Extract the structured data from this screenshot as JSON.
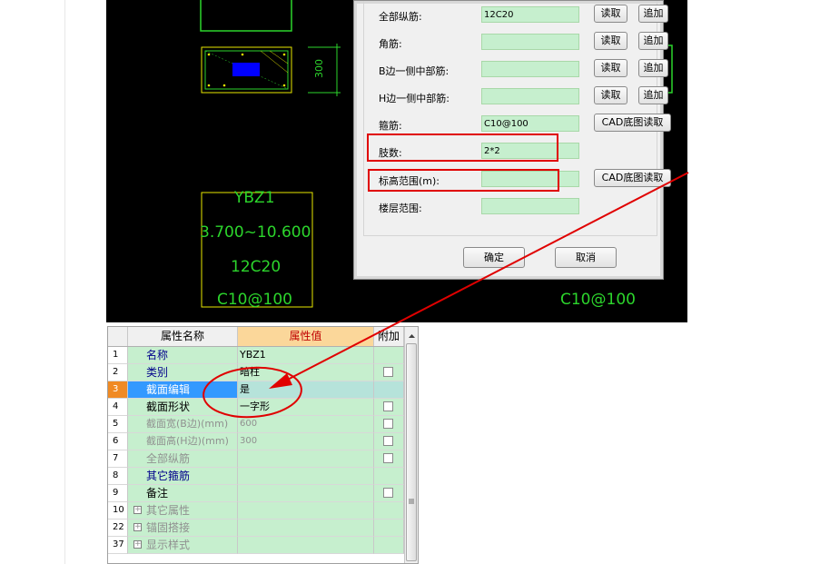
{
  "cad": {
    "dim_label": "300",
    "column_name": "YBZ1",
    "elevation": "3.700~10.600",
    "rebar": "12C20",
    "stirrup": "C10@100",
    "stirrup_right": "C10@100"
  },
  "dialog": {
    "fields": [
      {
        "label": "全部纵筋:",
        "value": "12C20",
        "read": "读取",
        "add": "追加"
      },
      {
        "label": "角筋:",
        "value": "",
        "read": "读取",
        "add": "追加"
      },
      {
        "label": "B边一侧中部筋:",
        "value": "",
        "read": "读取",
        "add": "追加"
      },
      {
        "label": "H边一侧中部筋:",
        "value": "",
        "read": "读取",
        "add": "追加"
      },
      {
        "label": "箍筋:",
        "value": "C10@100",
        "cad_read": "CAD底图读取"
      },
      {
        "label": "肢数:",
        "value": "2*2"
      },
      {
        "label": "标高范围(m):",
        "value": "",
        "cad_read": "CAD底图读取"
      },
      {
        "label": "楼层范围:",
        "value": ""
      }
    ],
    "ok": "确定",
    "cancel": "取消"
  },
  "grid": {
    "headers": {
      "num": "",
      "name": "属性名称",
      "value": "属性值",
      "add": "附加"
    },
    "rows": [
      {
        "num": "1",
        "name": "名称",
        "value": "YBZ1"
      },
      {
        "num": "2",
        "name": "类别",
        "value": "暗柱"
      },
      {
        "num": "3",
        "name": "截面编辑",
        "value": "是"
      },
      {
        "num": "4",
        "name": "截面形状",
        "value": "一字形"
      },
      {
        "num": "5",
        "name": "截面宽(B边)(mm)",
        "value": "600"
      },
      {
        "num": "6",
        "name": "截面高(H边)(mm)",
        "value": "300"
      },
      {
        "num": "7",
        "name": "全部纵筋",
        "value": ""
      },
      {
        "num": "8",
        "name": "其它箍筋",
        "value": ""
      },
      {
        "num": "9",
        "name": "备注",
        "value": ""
      },
      {
        "num": "10",
        "name": "其它属性",
        "value": ""
      },
      {
        "num": "22",
        "name": "锚固搭接",
        "value": ""
      },
      {
        "num": "37",
        "name": "显示样式",
        "value": ""
      }
    ]
  },
  "colors": {
    "annotation_red": "#e00000",
    "cad_green": "#2cd52c",
    "cad_yellow": "#e8e800",
    "field_green": "#c6efce",
    "selected_blue": "#3399ff"
  }
}
